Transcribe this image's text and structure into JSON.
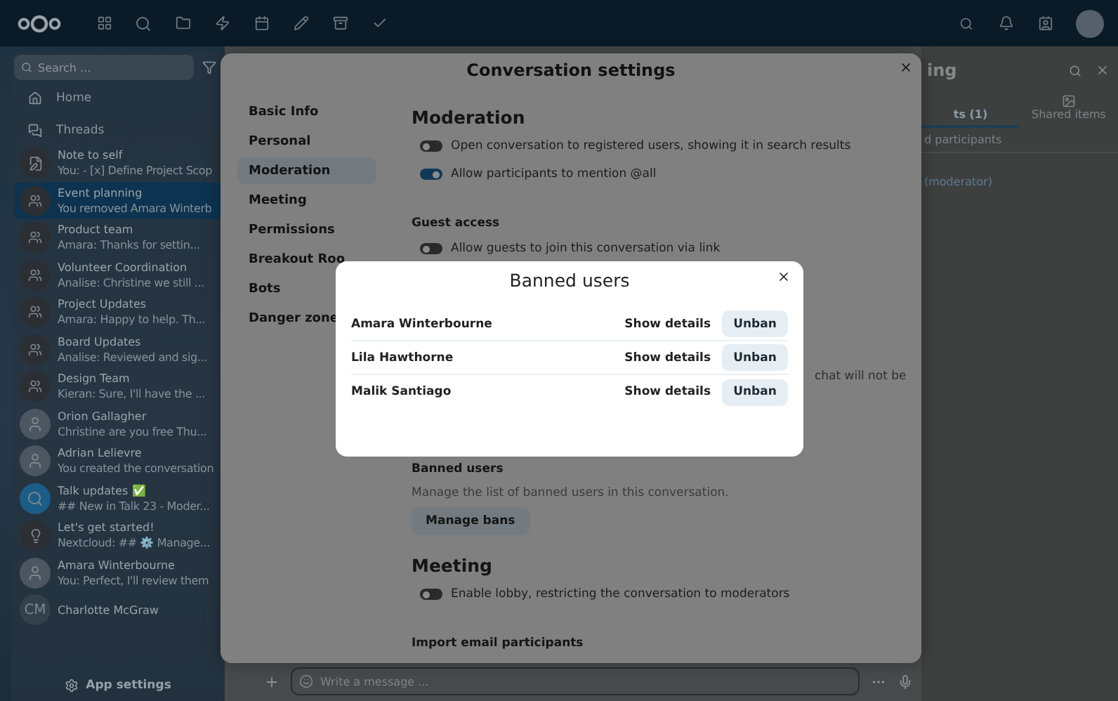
{
  "sidebar": {
    "search": {
      "placeholder": "Search ..."
    },
    "nav": [
      {
        "label": "Home",
        "kind": "home"
      },
      {
        "label": "Threads",
        "kind": "threads"
      }
    ],
    "conversations": [
      {
        "name": "Note to self",
        "preview": "You: - [x] Define Project Scop",
        "kind": "note",
        "selected": false
      },
      {
        "name": "Event planning",
        "preview": "You removed Amara Winterb",
        "kind": "group",
        "selected": true
      },
      {
        "name": "Product team",
        "preview": "Amara: Thanks for settin...",
        "kind": "group",
        "selected": false
      },
      {
        "name": "Volunteer Coordination",
        "preview": "Analise: Christine we still ...",
        "kind": "group",
        "selected": false
      },
      {
        "name": "Project Updates",
        "preview": "Amara: Happy to help. Th...",
        "kind": "group",
        "selected": false
      },
      {
        "name": "Board Updates",
        "preview": "Analise: Reviewed and sig...",
        "kind": "group",
        "selected": false
      },
      {
        "name": "Design Team",
        "preview": "Kieran: Sure, I'll have the ...",
        "kind": "group",
        "selected": false
      },
      {
        "name": "Orion Gallagher",
        "preview": "Christine are you free Thu...",
        "kind": "photo",
        "selected": false
      },
      {
        "name": "Adrian Lelievre",
        "preview": "You created the conversation",
        "kind": "photo",
        "selected": false
      },
      {
        "name": "Talk updates ✅",
        "preview": "## New in Talk 23 - Moder...",
        "kind": "talk",
        "selected": false
      },
      {
        "name": "Let's get started!",
        "preview": "Nextcloud: ## ⚙️ Manage...",
        "kind": "bulb",
        "selected": false
      },
      {
        "name": "Amara Winterbourne",
        "preview": "You: Perfect, I'll review them",
        "kind": "photo",
        "selected": false
      },
      {
        "name": "Charlotte McGraw",
        "kind": "initials",
        "initials": "CM",
        "selected": false
      }
    ],
    "footer": "App settings"
  },
  "composer": {
    "placeholder": "Write a message ..."
  },
  "right_panel": {
    "title": "ing",
    "tabs": [
      {
        "label": "ts (1)",
        "selected": true
      },
      {
        "label": "Shared items",
        "selected": false
      }
    ],
    "filter": "d participants",
    "participant": "(moderator)"
  },
  "settings_dialog": {
    "title": "Conversation settings",
    "nav": [
      {
        "label": "Basic Info",
        "selected": false
      },
      {
        "label": "Personal",
        "selected": false
      },
      {
        "label": "Moderation",
        "selected": true
      },
      {
        "label": "Meeting",
        "selected": false
      },
      {
        "label": "Permissions",
        "selected": false
      },
      {
        "label": "Breakout Roo",
        "selected": false
      },
      {
        "label": "Bots",
        "selected": false
      },
      {
        "label": "Danger zone",
        "selected": false
      }
    ],
    "content": [
      {
        "kind": "heading",
        "text": "Moderation"
      },
      {
        "kind": "toggle",
        "text": "Open conversation to registered users, showing it in search results",
        "on": false
      },
      {
        "kind": "toggle",
        "text": "Allow participants to mention @all",
        "on": true
      },
      {
        "kind": "subheading",
        "text": "Guest access"
      },
      {
        "kind": "toggle",
        "text": "Allow guests to join this conversation via link",
        "on": false
      },
      {
        "kind": "partial",
        "text": "chat will not be"
      },
      {
        "kind": "subheading",
        "text": "Banned users"
      },
      {
        "kind": "text",
        "text": "Manage the list of banned users in this conversation."
      },
      {
        "kind": "button",
        "text": "Manage bans"
      },
      {
        "kind": "heading",
        "text": "Meeting"
      },
      {
        "kind": "toggle",
        "text": "Enable lobby, restricting the conversation to moderators",
        "on": false
      },
      {
        "kind": "subheading",
        "text": "Import email participants"
      }
    ]
  },
  "banned_dialog": {
    "title": "Banned users",
    "users": [
      {
        "name": "Amara Winterbourne",
        "details": "Show details",
        "action": "Unban"
      },
      {
        "name": "Lila Hawthorne",
        "details": "Show details",
        "action": "Unban"
      },
      {
        "name": "Malik Santiago",
        "details": "Show details",
        "action": "Unban"
      }
    ]
  }
}
